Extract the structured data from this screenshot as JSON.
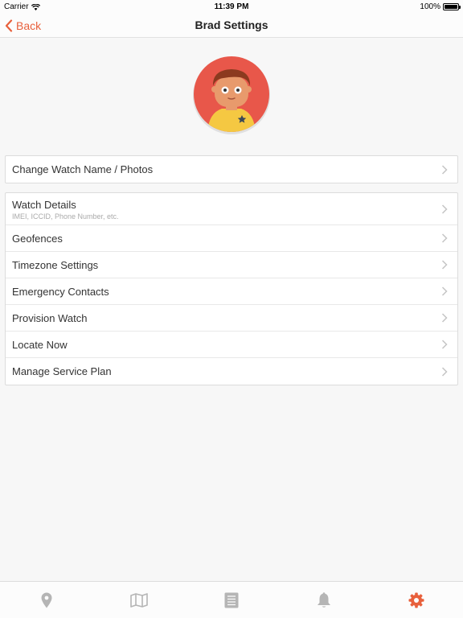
{
  "status_bar": {
    "carrier": "Carrier",
    "time": "11:39 PM",
    "battery": "100%"
  },
  "nav": {
    "back_label": "Back",
    "title": "Brad Settings"
  },
  "colors": {
    "accent": "#e8603c",
    "tab_inactive": "#b5b5b5",
    "avatar_bg": "#e8574a",
    "avatar_shirt": "#f5c842",
    "avatar_skin": "#e89a6c",
    "avatar_hair": "#8b3a1f"
  },
  "sections": {
    "profile": {
      "items": [
        {
          "label": "Change Watch Name / Photos"
        }
      ]
    },
    "watch": {
      "items": [
        {
          "label": "Watch Details",
          "subtitle": "IMEI, ICCID, Phone Number, etc."
        },
        {
          "label": "Geofences"
        },
        {
          "label": "Timezone Settings"
        },
        {
          "label": "Emergency Contacts"
        },
        {
          "label": "Provision Watch"
        },
        {
          "label": "Locate Now"
        },
        {
          "label": "Manage Service Plan"
        }
      ]
    }
  },
  "tabs": [
    {
      "icon": "location-pin-icon",
      "active": false
    },
    {
      "icon": "map-icon",
      "active": false
    },
    {
      "icon": "list-icon",
      "active": false
    },
    {
      "icon": "bell-icon",
      "active": false
    },
    {
      "icon": "gear-icon",
      "active": true
    }
  ]
}
